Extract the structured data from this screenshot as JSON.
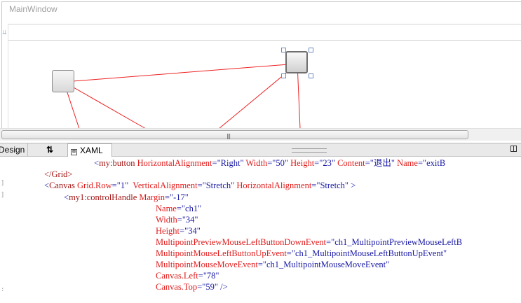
{
  "designer": {
    "window_title": "MainWindow",
    "row_marker": "⇊",
    "scroll_grip": "|||"
  },
  "tabs": {
    "design_label": "Design",
    "swap_label": "⇅",
    "xaml_icon": "⊠",
    "xaml_label": "XAML"
  },
  "xaml": {
    "line1": {
      "open": "<",
      "element": "my:button",
      "attrs": [
        {
          "name": "HorizontalAlignment",
          "value": "\"Right\""
        },
        {
          "name": "Width",
          "value": "\"50\""
        },
        {
          "name": "Height",
          "value": "\"23\""
        },
        {
          "name": "Content",
          "value": "\"退出\""
        },
        {
          "name": "Name",
          "value": "\"exitB"
        }
      ]
    },
    "line2": {
      "text": "</Grid>"
    },
    "line3": {
      "open": "<",
      "element": "Canvas",
      "attrs": [
        {
          "name": "Grid.Row",
          "value": "\"1\""
        },
        {
          "name": "VerticalAlignment",
          "value": "\"Stretch\""
        },
        {
          "name": "HorizontalAlignment",
          "value": "\"Stretch\""
        }
      ],
      "close": ">"
    },
    "line4": {
      "open": "<",
      "element": "my1:controlHandle",
      "attr": "Margin",
      "value": "\"-17\""
    },
    "attr_lines": [
      {
        "name": "Name",
        "value": "\"ch1\""
      },
      {
        "name": "Width",
        "value": "\"34\""
      },
      {
        "name": "Height",
        "value": "\"34\""
      },
      {
        "name": "MultipointPreviewMouseLeftButtonDownEvent",
        "value": "\"ch1_MultipointPreviewMouseLeftB"
      },
      {
        "name": "MultipointMouseLeftButtonUpEvent",
        "value": "\"ch1_MultipointMouseLeftButtonUpEvent\""
      },
      {
        "name": "MultipointMouseMoveEvent",
        "value": "\"ch1_MultipointMouseMoveEvent\""
      },
      {
        "name": "Canvas.Left",
        "value": "\"78\""
      },
      {
        "name": "Canvas.Top",
        "value": "\"59\"",
        "tail": " />"
      }
    ]
  }
}
